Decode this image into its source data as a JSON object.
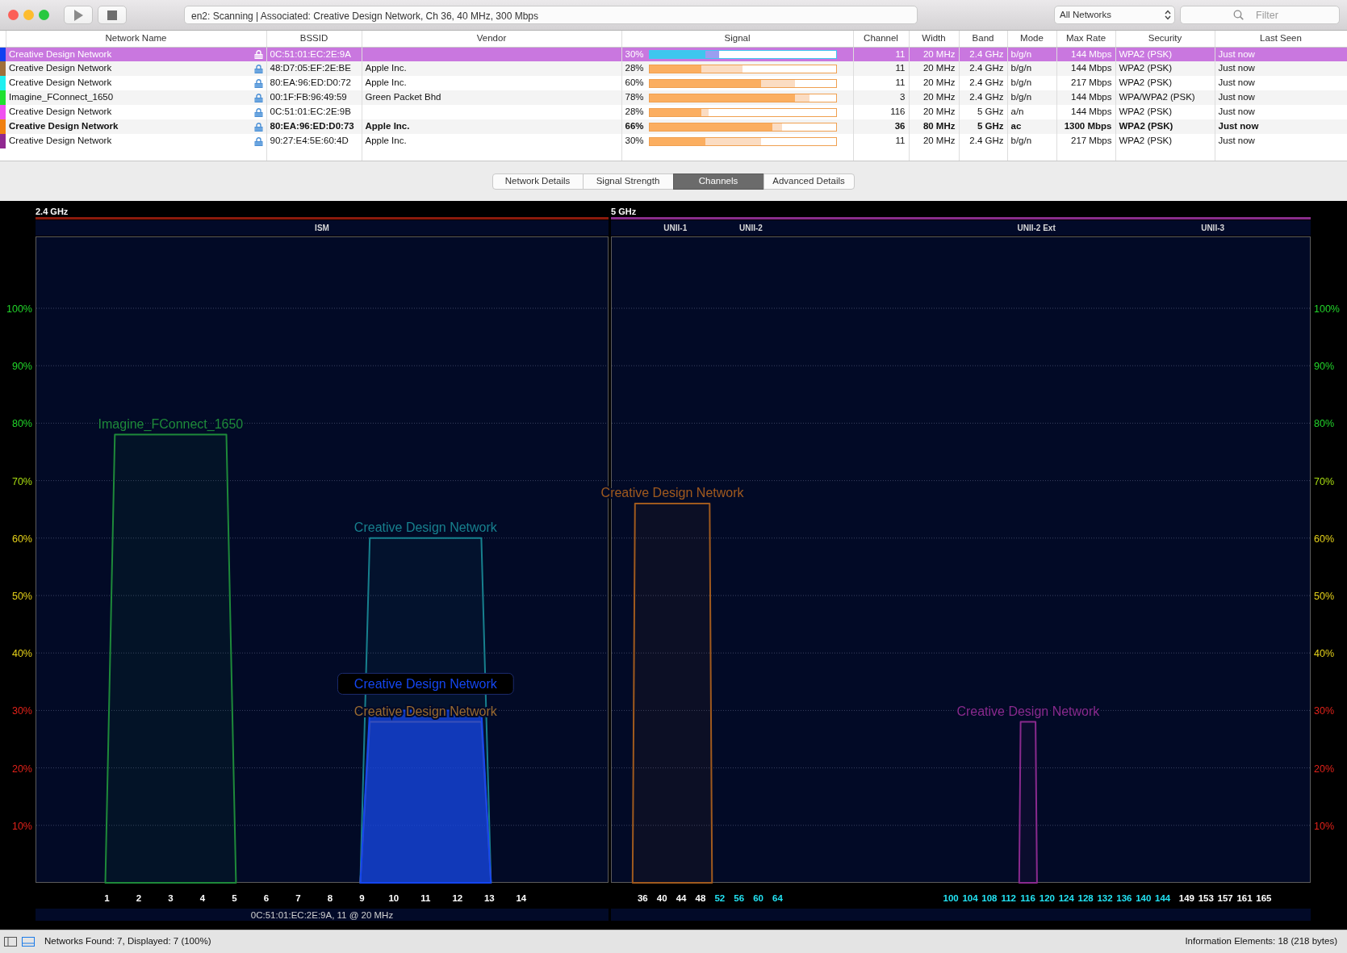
{
  "toolbar": {
    "status": "en2: Scanning | Associated: Creative Design Network, Ch 36, 40 MHz, 300 Mbps",
    "network_filter": "All Networks",
    "filter": {
      "placeholder": "Filter"
    }
  },
  "table": {
    "columns": [
      "Network Name",
      "BSSID",
      "Vendor",
      "Signal",
      "Channel",
      "Width",
      "Band",
      "Mode",
      "Max Rate",
      "Security",
      "Last Seen"
    ],
    "rows": [
      {
        "color": "#1040f0",
        "selected": true,
        "associated": false,
        "secured": true,
        "name": "Creative Design Network",
        "bssid": "0C:51:01:EC:2E:9A",
        "signal": "30%",
        "signal_bar": [
          {
            "kind": "current",
            "level": 0.3
          },
          {
            "kind": "peak",
            "level": 0.375
          }
        ],
        "channel": "11",
        "width": "20 MHz",
        "band": "2.4 GHz",
        "mode": "b/g/n",
        "max_rate": "144 Mbps",
        "security": "WPA2 (PSK)",
        "last_seen": "Just now"
      },
      {
        "color": "#a0703a",
        "selected": false,
        "associated": false,
        "secured": true,
        "name": "Creative Design Network",
        "bssid": "48:D7:05:EF:2E:BE",
        "vendor": "Apple Inc.",
        "signal": "28%",
        "signal_bar": [
          {
            "kind": "current",
            "level": 0.28
          },
          {
            "kind": "peak",
            "level": 0.5
          }
        ],
        "channel": "11",
        "width": "20 MHz",
        "band": "2.4 GHz",
        "mode": "b/g/n",
        "max_rate": "144 Mbps",
        "security": "WPA2 (PSK)",
        "last_seen": "Just now"
      },
      {
        "color": "#20f0f0",
        "selected": false,
        "associated": false,
        "secured": true,
        "name": "Creative Design Network",
        "bssid": "80:EA:96:ED:D0:72",
        "vendor": "Apple Inc.",
        "signal": "60%",
        "signal_bar": [
          {
            "kind": "current",
            "level": 0.6
          },
          {
            "kind": "peak",
            "level": 0.78
          }
        ],
        "channel": "11",
        "width": "20 MHz",
        "band": "2.4 GHz",
        "mode": "b/g/n",
        "max_rate": "217 Mbps",
        "security": "WPA2 (PSK)",
        "last_seen": "Just now"
      },
      {
        "color": "#20e030",
        "selected": false,
        "associated": false,
        "secured": true,
        "name": "Imagine_FConnect_1650",
        "bssid": "00:1F:FB:96:49:59",
        "vendor": "Green Packet Bhd",
        "signal": "78%",
        "signal_bar": [
          {
            "kind": "current",
            "level": 0.78
          },
          {
            "kind": "peak",
            "level": 0.86
          }
        ],
        "channel": "3",
        "width": "20 MHz",
        "band": "2.4 GHz",
        "mode": "b/g/n",
        "max_rate": "144 Mbps",
        "security": "WPA/WPA2 (PSK)",
        "last_seen": "Just now"
      },
      {
        "color": "#f050f0",
        "selected": false,
        "associated": false,
        "secured": true,
        "name": "Creative Design Network",
        "bssid": "0C:51:01:EC:2E:9B",
        "signal": "28%",
        "signal_bar": [
          {
            "kind": "current",
            "level": 0.28
          },
          {
            "kind": "peak",
            "level": 0.32
          }
        ],
        "channel": "116",
        "width": "20 MHz",
        "band": "5 GHz",
        "mode": "a/n",
        "max_rate": "144 Mbps",
        "security": "WPA2 (PSK)",
        "last_seen": "Just now"
      },
      {
        "color": "#f08010",
        "selected": false,
        "associated": true,
        "secured": true,
        "name": "Creative Design Network",
        "bssid": "80:EA:96:ED:D0:73",
        "vendor": "Apple Inc.",
        "signal": "66%",
        "signal_bar": [
          {
            "kind": "current",
            "level": 0.66
          },
          {
            "kind": "peak",
            "level": 0.71
          }
        ],
        "channel": "36",
        "width": "80 MHz",
        "band": "5 GHz",
        "mode": "ac",
        "max_rate": "1300 Mbps",
        "security": "WPA2 (PSK)",
        "last_seen": "Just now"
      },
      {
        "color": "#902890",
        "selected": false,
        "associated": false,
        "secured": true,
        "name": "Creative Design Network",
        "bssid": "90:27:E4:5E:60:4D",
        "vendor": "Apple Inc.",
        "signal": "30%",
        "signal_bar": [
          {
            "kind": "current",
            "level": 0.3
          },
          {
            "kind": "peak",
            "level": 0.6
          }
        ],
        "channel": "11",
        "width": "20 MHz",
        "band": "2.4 GHz",
        "mode": "b/g/n",
        "max_rate": "217 Mbps",
        "security": "WPA2 (PSK)",
        "last_seen": "Just now"
      }
    ]
  },
  "tabs": [
    {
      "label": "Network Details",
      "selected": false
    },
    {
      "label": "Signal Strength",
      "selected": false
    },
    {
      "label": "Channels",
      "selected": true
    },
    {
      "label": "Advanced Details",
      "selected": false
    }
  ],
  "channel_graph": {
    "bands": [
      {
        "title": "2.4 GHz",
        "color": "#8c1a0c",
        "subbands": [
          {
            "label": "ISM"
          }
        ],
        "traces": [
          {
            "selected": false
          },
          {
            "selected": false
          },
          {
            "selected": false
          },
          {
            "selected": true
          }
        ],
        "caption": "0C:51:01:EC:2E:9A, 11 @ 20 MHz",
        "chart_data": {
          "type": "area",
          "grid": true,
          "xlim": [
            -1.24,
            16.74
          ],
          "ylim": [
            0,
            112.5
          ],
          "x": [
            0.95,
            1.25,
            4.75,
            5.05,
            8.95,
            9.25,
            12.75,
            13.05
          ],
          "series": [
            {
              "name": "Imagine_FConnect_1650",
              "color": "#1e8a3a",
              "values": [
                0,
                78,
                78,
                0,
                null,
                null,
                null,
                null
              ]
            },
            {
              "name": "Creative Design Network",
              "color": "#17808e",
              "values": [
                null,
                null,
                null,
                null,
                0,
                60,
                60,
                0
              ]
            },
            {
              "name": "Creative Design Network",
              "color": "#9a6a30",
              "values": [
                null,
                null,
                null,
                null,
                0,
                28,
                28,
                0
              ]
            },
            {
              "name": "Creative Design Network",
              "color": "#1446f0",
              "values": [
                null,
                null,
                null,
                null,
                0,
                30,
                30,
                0
              ]
            }
          ],
          "xticks": [
            1,
            2,
            3,
            4,
            5,
            6,
            7,
            8,
            9,
            10,
            11,
            12,
            13,
            14
          ],
          "yticks": [
            {
              "value": 10,
              "label": "10%"
            },
            {
              "value": 20,
              "label": "20%"
            },
            {
              "value": 30,
              "label": "30%"
            },
            {
              "value": 40,
              "label": "40%"
            },
            {
              "value": 50,
              "label": "50%"
            },
            {
              "value": 60,
              "label": "60%"
            },
            {
              "value": 70,
              "label": "70%"
            },
            {
              "value": 80,
              "label": "80%"
            },
            {
              "value": 90,
              "label": "90%"
            },
            {
              "value": 100,
              "label": "100%"
            }
          ]
        }
      },
      {
        "title": "5 GHz",
        "color": "#8a2d8c",
        "subbands": [
          {
            "label": "UNII-1"
          },
          {
            "label": "UNII-2"
          },
          {
            "label": "UNII-2 Ext"
          },
          {
            "label": "UNII-3"
          }
        ],
        "traces": [
          {
            "selected": false
          },
          {
            "selected": false
          }
        ],
        "chart_data": {
          "type": "area",
          "grid": true,
          "xlim": [
            29.4,
            174.75
          ],
          "ylim": [
            0,
            112.5
          ],
          "x": [
            33.9,
            34.4,
            49.9,
            50.4,
            114.2,
            114.5,
            117.6,
            117.9
          ],
          "series": [
            {
              "name": "Creative Design Network",
              "color": "#a05a1e",
              "values": [
                0,
                66,
                66,
                0,
                null,
                null,
                null,
                null
              ]
            },
            {
              "name": "Creative Design Network",
              "color": "#8a2a8e",
              "values": [
                null,
                null,
                null,
                null,
                0,
                28,
                28,
                0
              ]
            }
          ],
          "xticks": [
            36,
            40,
            44,
            48,
            52,
            56,
            60,
            64,
            100,
            104,
            108,
            112,
            116,
            120,
            124,
            128,
            132,
            136,
            140,
            144,
            149,
            153,
            157,
            161,
            165
          ],
          "yticks": [
            {
              "value": 10,
              "label": "10%"
            },
            {
              "value": 20,
              "label": "20%"
            },
            {
              "value": 30,
              "label": "30%"
            },
            {
              "value": 40,
              "label": "40%"
            },
            {
              "value": 50,
              "label": "50%"
            },
            {
              "value": 60,
              "label": "60%"
            },
            {
              "value": 70,
              "label": "70%"
            },
            {
              "value": 80,
              "label": "80%"
            },
            {
              "value": 90,
              "label": "90%"
            },
            {
              "value": 100,
              "label": "100%"
            }
          ]
        },
        "tick_states": [
          {
            "highlighted": false
          },
          {
            "highlighted": false
          },
          {
            "highlighted": false
          },
          {
            "highlighted": false
          },
          {
            "highlighted": true
          },
          {
            "highlighted": true
          },
          {
            "highlighted": true
          },
          {
            "highlighted": true
          },
          {
            "highlighted": true
          },
          {
            "highlighted": true
          },
          {
            "highlighted": true
          },
          {
            "highlighted": true
          },
          {
            "highlighted": true
          },
          {
            "highlighted": true
          },
          {
            "highlighted": true
          },
          {
            "highlighted": true
          },
          {
            "highlighted": true
          },
          {
            "highlighted": true
          },
          {
            "highlighted": true
          },
          {
            "highlighted": true
          },
          {
            "highlighted": false
          },
          {
            "highlighted": false
          },
          {
            "highlighted": false
          },
          {
            "highlighted": false
          },
          {
            "highlighted": false
          }
        ]
      }
    ]
  },
  "status_bar": {
    "view_toggles": [
      {
        "selected": false
      },
      {
        "selected": true
      }
    ],
    "left": "Networks Found: 7, Displayed: 7 (100%)",
    "right": "Information Elements: 18 (218 bytes)"
  }
}
